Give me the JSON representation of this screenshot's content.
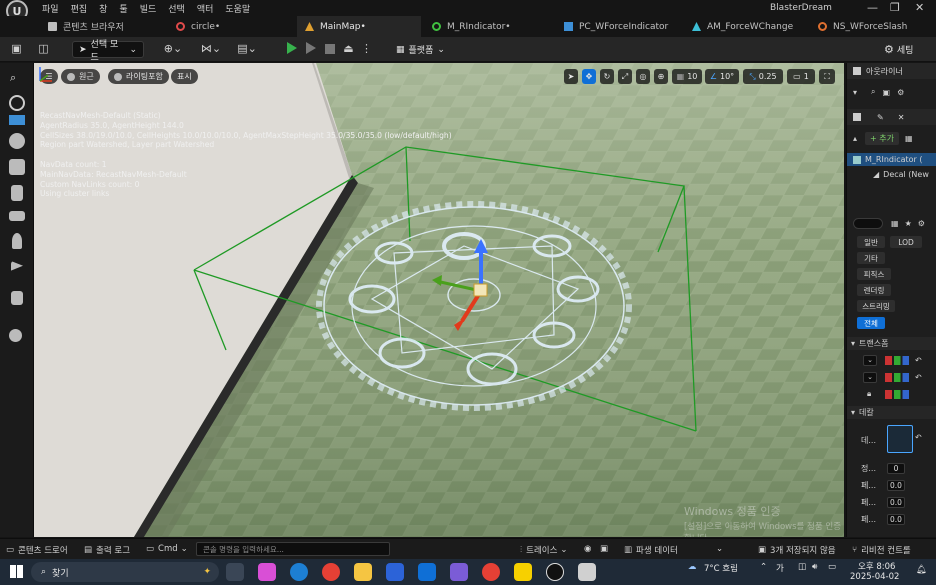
{
  "menubar": {
    "logo_text": "U",
    "items": [
      "파일",
      "편집",
      "창",
      "툴",
      "빌드",
      "선택",
      "액터",
      "도움말"
    ],
    "app_title": "BlasterDream",
    "window_controls": [
      "—",
      "❐",
      "✕"
    ]
  },
  "tabs": [
    {
      "label": "콘텐츠 브라우저",
      "icon": "folder-icon",
      "color": "#bfbfbf"
    },
    {
      "label": "circle•",
      "icon": "niagara-icon",
      "color": "#e04a4a"
    },
    {
      "label": "MainMap•",
      "icon": "level-icon",
      "color": "#e0a030"
    },
    {
      "label": "M_RIndicator•",
      "icon": "material-icon",
      "color": "#40c040"
    },
    {
      "label": "PC_WForceIndicator",
      "icon": "blueprint-icon",
      "color": "#3d8fd6"
    },
    {
      "label": "AM_ForceWChange",
      "icon": "anim-montage-icon",
      "color": "#3dbfd6"
    },
    {
      "label": "NS_WForceSlash",
      "icon": "niagara-icon",
      "color": "#e07030"
    }
  ],
  "toolbar": {
    "select_mode": "선택 모드",
    "platforms": "플랫폼",
    "settings": "세팅"
  },
  "viewport": {
    "pills": [
      "원근",
      "라이팅포함",
      "표시"
    ],
    "right_controls": [
      "10",
      "10°",
      "0.25",
      "1"
    ],
    "nav_info": [
      "RecastNavMesh-Default (Static)",
      "AgentRadius 35.0, AgentHeight 144.0",
      "CellSizes 38.0/19.0/10.0, CellHeights 10.0/10.0/10.0, AgentMaxStepHeight 35.0/35.0/35.0 (low/default/high)",
      "Region part Watershed, Layer part Watershed",
      "",
      "NavData count: 1",
      "MainNavData: RecastNavMesh-Default",
      "Custom NavLinks count: 0",
      "Using cluster links"
    ],
    "watermark_title": "Windows 정품 인증",
    "watermark_sub": "[설정]으로 이동하여 Windows를 정품 인증합니다."
  },
  "outliner": {
    "title": "아웃라이너"
  },
  "details": {
    "add_label": "+ 추가",
    "component_root": "M_RIndicator (",
    "component_child": "Decal (New",
    "filters": [
      "일반",
      "LOD",
      "기타",
      "피직스",
      "렌더링",
      "스트리밍",
      "전체"
    ],
    "section_transform": "트랜스폼",
    "section_decal": "데칼",
    "decal_label": "데...",
    "rows": [
      {
        "label": "정...",
        "value": "0"
      },
      {
        "label": "페...",
        "value": "0.0"
      },
      {
        "label": "페...",
        "value": "0.0"
      },
      {
        "label": "페...",
        "value": "0.0"
      }
    ]
  },
  "bottombar": {
    "content_drawer": "콘텐츠 드로어",
    "output_log": "출력 로그",
    "cmd": "Cmd",
    "cmd_placeholder": "콘솔 명령을 입력하세요...",
    "trace": "트레이스",
    "derived_data": "파생 데이터",
    "unsaved": "3개 저장되지 않음",
    "source_control": "리비전 컨트롤"
  },
  "taskbar": {
    "search": "찾기",
    "weather": "7°C 흐림",
    "time": "오후 8:06",
    "date": "2025-04-02"
  }
}
